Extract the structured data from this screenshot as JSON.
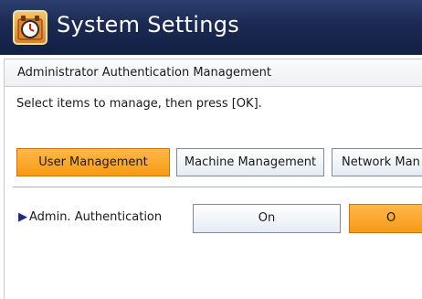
{
  "window": {
    "title": "System Settings",
    "icon": "system-settings-clock-icon"
  },
  "panel": {
    "header": "Administrator Authentication Management",
    "instruction": "Select items to manage, then press [OK]."
  },
  "tabs": [
    {
      "label": "User Management",
      "selected": true
    },
    {
      "label": "Machine Management",
      "selected": false
    },
    {
      "label": "Network Man",
      "selected": false
    }
  ],
  "setting": {
    "label": "Admin. Authentication",
    "arrow": "▶",
    "options": [
      {
        "label": "On",
        "selected": false
      },
      {
        "label": "O",
        "selected": true
      }
    ]
  },
  "colors": {
    "titlebar": "#1b2a52",
    "selected": "#f79a14",
    "arrow": "#1f2b82"
  }
}
